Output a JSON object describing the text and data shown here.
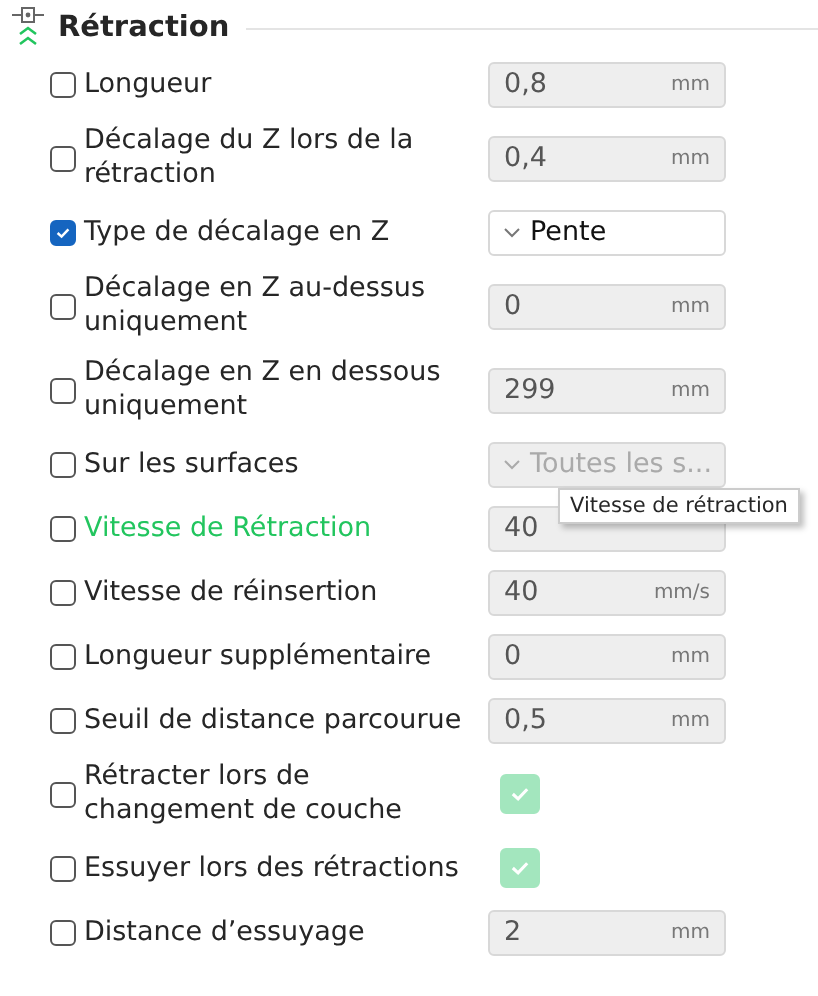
{
  "section": {
    "title": "Rétraction"
  },
  "rows": [
    {
      "label": "Longueur",
      "checked": false,
      "highlighted": false,
      "kind": "number",
      "value": "0,8",
      "unit": "mm",
      "disabled": true
    },
    {
      "label": "Décalage du Z lors de la rétraction",
      "checked": false,
      "highlighted": false,
      "kind": "number",
      "value": "0,4",
      "unit": "mm",
      "disabled": true
    },
    {
      "label": "Type de décalage en Z",
      "checked": true,
      "highlighted": false,
      "kind": "dropdown",
      "value": "Pente",
      "disabled": false
    },
    {
      "label": "Décalage en Z au-dessus uniquement",
      "checked": false,
      "highlighted": false,
      "kind": "number",
      "value": "0",
      "unit": "mm",
      "disabled": true
    },
    {
      "label": "Décalage en Z en dessous uniquement",
      "checked": false,
      "highlighted": false,
      "kind": "number",
      "value": "299",
      "unit": "mm",
      "disabled": true
    },
    {
      "label": "Sur les surfaces",
      "checked": false,
      "highlighted": false,
      "kind": "dropdown",
      "value": "Toutes les s...",
      "disabled": true
    },
    {
      "label": "Vitesse de Rétraction",
      "checked": false,
      "highlighted": true,
      "kind": "number",
      "value": "40",
      "disabled": true,
      "tooltip": "Vitesse de rétraction"
    },
    {
      "label": "Vitesse de réinsertion",
      "checked": false,
      "highlighted": false,
      "kind": "number",
      "value": "40",
      "unit": "mm/s",
      "disabled": true
    },
    {
      "label": "Longueur supplémentaire",
      "checked": false,
      "highlighted": false,
      "kind": "number",
      "value": "0",
      "unit": "mm",
      "disabled": true
    },
    {
      "label": "Seuil de distance parcourue",
      "checked": false,
      "highlighted": false,
      "kind": "number",
      "value": "0,5",
      "unit": "mm",
      "disabled": true
    },
    {
      "label": "Rétracter lors de changement de couche",
      "checked": false,
      "highlighted": false,
      "kind": "toggle",
      "on": true,
      "disabled": true
    },
    {
      "label": "Essuyer lors des rétractions",
      "checked": false,
      "highlighted": false,
      "kind": "toggle",
      "on": true,
      "disabled": true
    },
    {
      "label": "Distance d’essuyage",
      "checked": false,
      "highlighted": false,
      "kind": "number",
      "value": "2",
      "unit": "mm",
      "disabled": true
    }
  ]
}
